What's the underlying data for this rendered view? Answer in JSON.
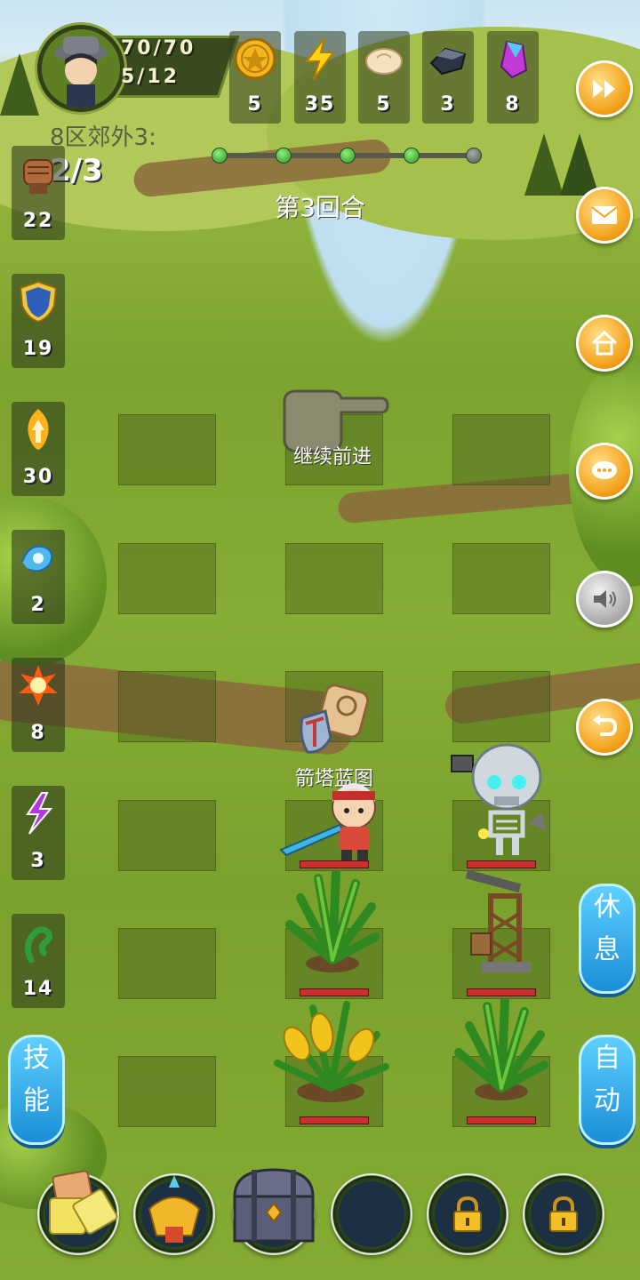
{
  "player": {
    "hp": "70/70",
    "energy": "5/12"
  },
  "resources": [
    {
      "icon": "gold-coin-icon",
      "value": "5"
    },
    {
      "icon": "lightning-icon",
      "value": "35"
    },
    {
      "icon": "bun-icon",
      "value": "5"
    },
    {
      "icon": "iron-ore-icon",
      "value": "3"
    },
    {
      "icon": "crystal-icon",
      "value": "8"
    }
  ],
  "stage": {
    "name": "8区郊外3:",
    "wave": "2/3",
    "round": "第3回合",
    "progress_total": 5,
    "progress_done": 4
  },
  "skills": [
    {
      "icon": "fist-icon",
      "value": "22"
    },
    {
      "icon": "shield-icon",
      "value": "19"
    },
    {
      "icon": "flame-arrow-icon",
      "value": "30"
    },
    {
      "icon": "water-wave-icon",
      "value": "2"
    },
    {
      "icon": "fire-burst-icon",
      "value": "8"
    },
    {
      "icon": "purple-lightning-icon",
      "value": "3"
    },
    {
      "icon": "green-tentacle-icon",
      "value": "14"
    }
  ],
  "right_buttons": [
    "fast-forward-icon",
    "mail-icon",
    "home-icon",
    "chat-icon",
    "sound-icon",
    "return-icon"
  ],
  "board": {
    "continue_label": "继续前进",
    "item_label": "箭塔蓝图"
  },
  "side_buttons": {
    "rest": "休息",
    "skill": "技能",
    "auto": "自动"
  },
  "bottom_slots": [
    "crackers-icon",
    "golden-helmet-icon",
    "treasure-chest-icon",
    "empty-slot",
    "lock-icon",
    "lock-icon"
  ],
  "colors": {
    "accent": "#f3a21b",
    "blue_button": "#1a8ed8",
    "hp_bar": "#c9302c"
  }
}
